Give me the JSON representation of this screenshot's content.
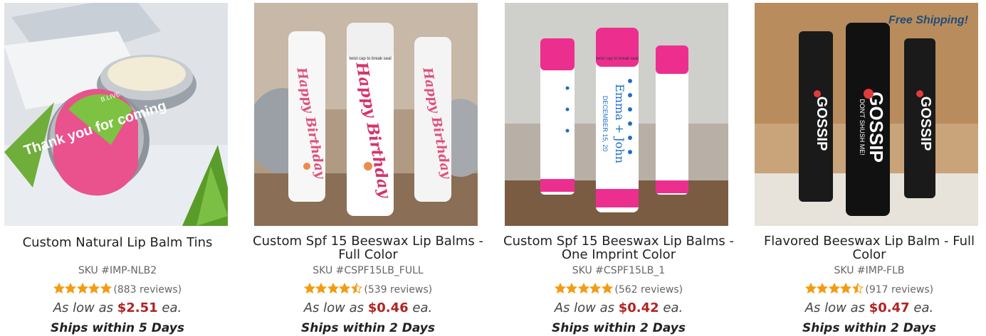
{
  "products": [
    {
      "title": "Custom Natural Lip Balm Tins",
      "sku": "SKU #IMP-NLB2",
      "rating": 5,
      "reviews": "(883 reviews)",
      "price_prefix": "As low as",
      "price": "$2.51",
      "price_suffix": "ea.",
      "shipping": "Ships within 5 Days",
      "badge": "",
      "image_label": "Thank you for coming",
      "image_brand": "B.LIVE"
    },
    {
      "title": "Custom Spf 15 Beeswax Lip Balms - Full Color",
      "sku": "SKU #CSPF15LB_FULL",
      "rating": 4.5,
      "reviews": "(539 reviews)",
      "price_prefix": "As low as",
      "price": "$0.46",
      "price_suffix": "ea.",
      "shipping": "Ships within 2 Days",
      "badge": "",
      "image_label": "Happy Birthday",
      "image_seal": "twist cap to break seal"
    },
    {
      "title": "Custom Spf 15 Beeswax Lip Balms - One Imprint Color",
      "sku": "SKU #CSPF15LB_1",
      "rating": 5,
      "reviews": "(562 reviews)",
      "price_prefix": "As low as",
      "price": "$0.42",
      "price_suffix": "ea.",
      "shipping": "Ships within 2 Days",
      "badge": "",
      "image_label": "Emma + John",
      "image_sublabel": "DECEMBER 15, 20",
      "image_seal": "twist cap to break seal"
    },
    {
      "title": "Flavored Beeswax Lip Balm - Full Color",
      "sku": "SKU #IMP-FLB",
      "rating": 4.5,
      "reviews": "(917 reviews)",
      "price_prefix": "As low as",
      "price": "$0.47",
      "price_suffix": "ea.",
      "shipping": "Ships within 2 Days",
      "badge": "Free Shipping!",
      "image_label": "GOSSIP",
      "image_sublabel": "DON'T SHUSH ME!"
    }
  ],
  "colors": {
    "star": "#f39c12",
    "price": "#b22222",
    "badge": "#1f4e79"
  }
}
